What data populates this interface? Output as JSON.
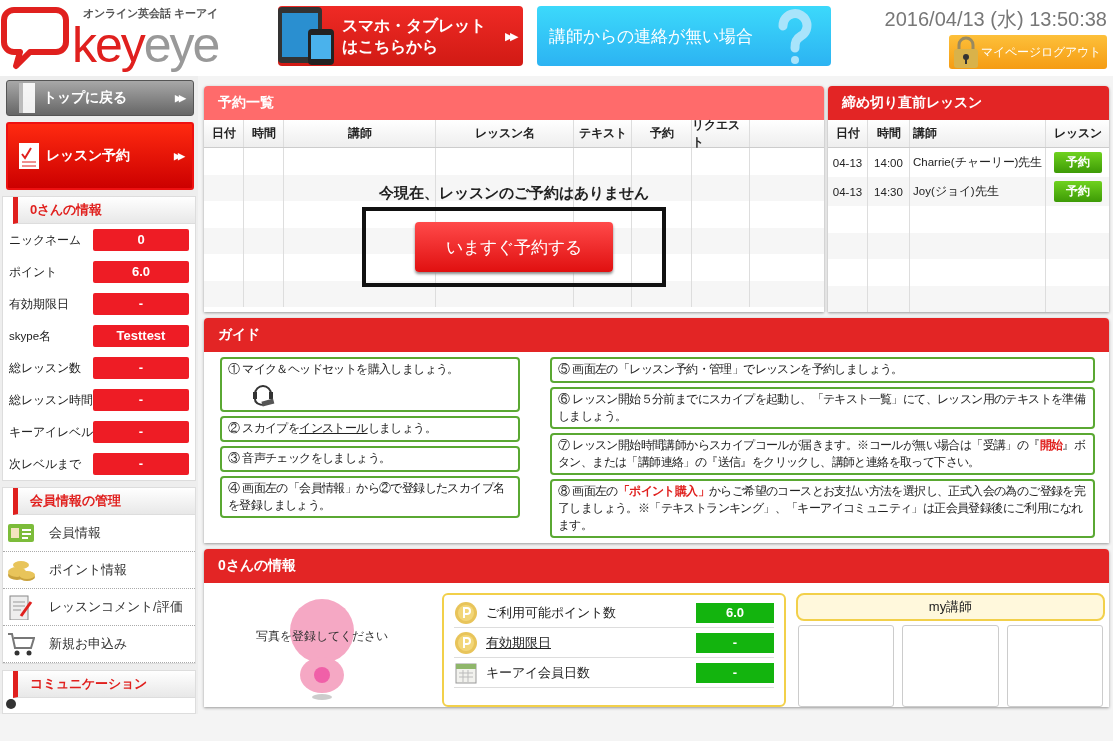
{
  "header": {
    "logo": {
      "tagline": "オンライン英会話 キーアイ",
      "wordmark": [
        "key",
        "eye"
      ]
    },
    "banners": [
      {
        "kind": "mobile",
        "line1": "スマホ・タブレット",
        "line2": "はこちらから",
        "arrow": "▶▶"
      },
      {
        "kind": "help",
        "line1": "講師からの連絡が無い場合"
      }
    ],
    "datetime": "2016/04/13 (水) 13:50:38",
    "logout": "マイページログアウト"
  },
  "sidebar": {
    "nav": [
      {
        "kind": "top",
        "label": "トップに戻る",
        "arrow": "▶▶"
      },
      {
        "kind": "reserve",
        "label": "レッスン予約",
        "arrow": "▶▶"
      }
    ],
    "profile": {
      "title": "0さんの情報",
      "rows": [
        {
          "label": "ニックネーム",
          "value": "0"
        },
        {
          "label": "ポイント",
          "value": "6.0"
        },
        {
          "label": "有効期限日",
          "value": "-"
        },
        {
          "label": "skype名",
          "value": "Testtest"
        },
        {
          "label": "総レッスン数",
          "value": "-"
        },
        {
          "label": "総レッスン時間",
          "value": "-"
        },
        {
          "label": "キーアイレベル",
          "value": "-"
        },
        {
          "label": "次レベルまで",
          "value": "-"
        }
      ]
    },
    "member": {
      "title": "会員情報の管理",
      "items": [
        {
          "kind": "card",
          "label": "会員情報"
        },
        {
          "kind": "coins",
          "label": "ポイント情報"
        },
        {
          "kind": "clipboard",
          "label": "レッスンコメント/評価"
        },
        {
          "kind": "cart",
          "label": "新規お申込み"
        }
      ]
    },
    "community": {
      "title": "コミュニケーション"
    }
  },
  "reservations": {
    "title": "予約一覧",
    "columns": [
      "日付",
      "時間",
      "講師",
      "レッスン名",
      "テキスト",
      "予約",
      "リクエスト"
    ],
    "empty_message": "今現在、レッスンのご予約はありません",
    "book_button": "いますぐ予約する"
  },
  "deadline": {
    "title": "締め切り直前レッスン",
    "columns": [
      "日付",
      "時間",
      "講師",
      "レッスン"
    ],
    "rows": [
      {
        "date": "04-13",
        "time": "14:00",
        "teacher": "Charrie(チャーリー)先生",
        "button": "予約"
      },
      {
        "date": "04-13",
        "time": "14:30",
        "teacher": "Joy(ジョイ)先生",
        "button": "予約"
      }
    ]
  },
  "guide": {
    "title": "ガイド",
    "left": [
      {
        "kind": "with-icon",
        "text": "① マイク＆ヘッドセットを購入しましょう。"
      },
      {
        "kind": "link",
        "text": "② スカイプを",
        "link": "インストール",
        "after": "しましょう。"
      },
      {
        "kind": "plain",
        "text": "③ 音声チェックをしましょう。"
      },
      {
        "kind": "plain",
        "text": "④ 画面左の「会員情報」から②で登録したスカイプ名を登録しましょう。"
      }
    ],
    "right": [
      {
        "kind": "plain",
        "text": "⑤ 画面左の「レッスン予約・管理」でレッスンを予約しましょう。"
      },
      {
        "kind": "plain",
        "text": "⑥ レッスン開始５分前までにスカイプを起動し、「テキスト一覧」にて、レッスン用のテキストを準備しましょう。"
      },
      {
        "kind": "plain",
        "text": "⑦ レッスン開始時間講師からスカイプコールが届きます。※コールが無い場合は「受講」の『**開始**』ボタン、または「講師連絡」の『送信』をクリックし、講師と連絡を取って下さい。"
      },
      {
        "kind": "plain",
        "text": "⑧ 画面左の**「ポイント購入」**からご希望のコースとお支払い方法を選択し、正式入会の為のご登録を完了しましょう。※「テキストランキング」、「キーアイコミュニティ」は正会員登録後にご利用になれます。"
      }
    ]
  },
  "info": {
    "title": "0さんの情報",
    "photo_caption": "写真を登録してください",
    "stats": [
      {
        "kind": "coin",
        "label": "ご利用可能ポイント数",
        "value": "6.0",
        "link": false
      },
      {
        "kind": "coin",
        "label": "有効期限日",
        "value": "-",
        "link": true
      },
      {
        "kind": "calendar",
        "label": "キーアイ会員日数",
        "value": "-",
        "link": false
      }
    ],
    "teachers": {
      "title": "my講師"
    }
  }
}
